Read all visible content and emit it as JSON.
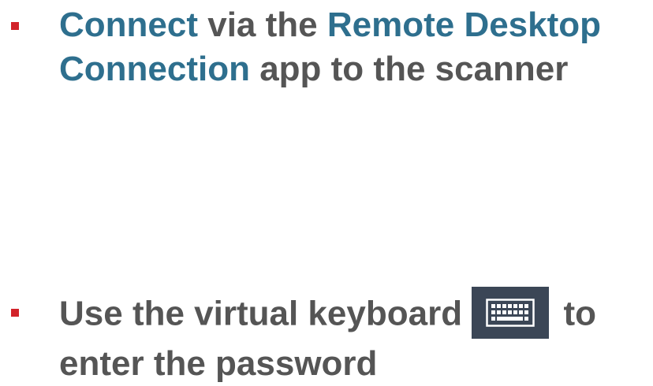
{
  "items": [
    {
      "line1": {
        "a": "Connect",
        "b": " via the ",
        "c": "Remote Desktop"
      },
      "line2": {
        "a": "Connection",
        "b": " app to the scanner"
      }
    },
    {
      "line1": {
        "a": "Use the virtual keyboard ",
        "icon": "keyboard-icon",
        "b": " to"
      },
      "line2": {
        "a": "enter the password"
      }
    }
  ],
  "colors": {
    "bullet": "#d2232a",
    "body_text": "#555555",
    "highlight": "#2e6f8e",
    "icon_bg": "#3b4656",
    "icon_fg": "#ffffff"
  }
}
